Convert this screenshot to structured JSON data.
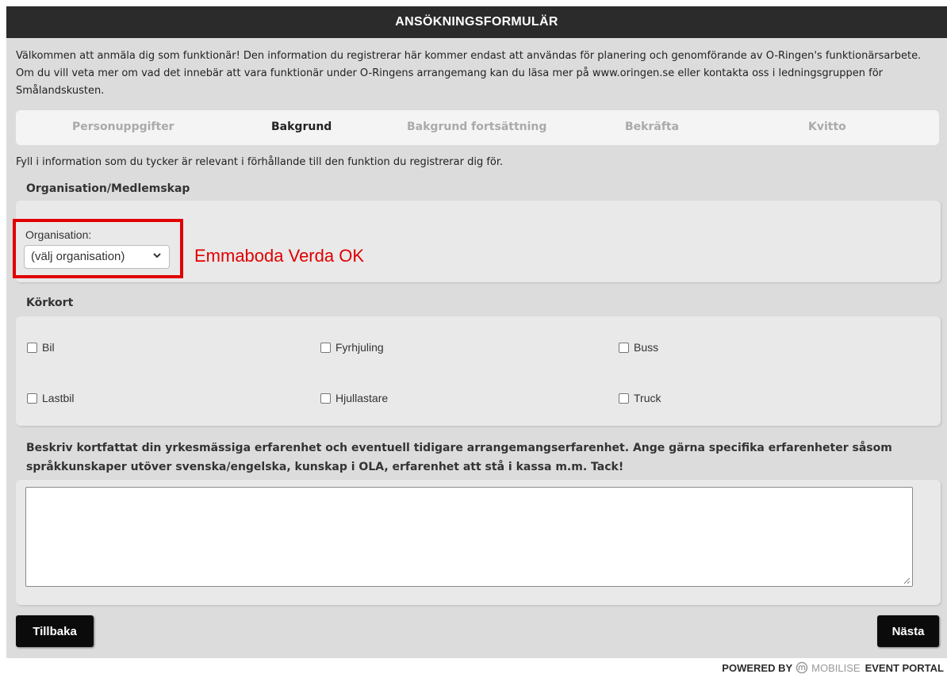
{
  "header": {
    "title": "ANSÖKNINGSFORMULÄR"
  },
  "intro": "Välkommen att anmäla dig som funktionär! Den information du registrerar här kommer endast att användas för planering och genomförande av O-Ringen's funktionärsarbete. Om du vill veta mer om vad det innebär att vara funktionär under O-Ringens arrangemang kan du läsa mer på www.oringen.se eller kontakta oss i ledningsgruppen för Smålandskusten.",
  "steps": [
    {
      "label": "Personuppgifter",
      "active": false
    },
    {
      "label": "Bakgrund",
      "active": true
    },
    {
      "label": "Bakgrund fortsättning",
      "active": false
    },
    {
      "label": "Bekräfta",
      "active": false
    },
    {
      "label": "Kvitto",
      "active": false
    }
  ],
  "lead_text": "Fyll i information som du tycker är relevant i förhållande till den funktion du registrerar dig för.",
  "organisation_section": {
    "title": "Organisation/Medlemskap",
    "label": "Organisation:",
    "select_value": "(välj organisation)",
    "annotation": "Emmaboda Verda OK",
    "annotation_color": "#e00000"
  },
  "license_section": {
    "title": "Körkort",
    "options": [
      {
        "label": "Bil",
        "checked": false
      },
      {
        "label": "Fyrhjuling",
        "checked": false
      },
      {
        "label": "Buss",
        "checked": false
      },
      {
        "label": "Lastbil",
        "checked": false
      },
      {
        "label": "Hjullastare",
        "checked": false
      },
      {
        "label": "Truck",
        "checked": false
      }
    ]
  },
  "experience": {
    "prompt": "Beskriv kortfattat din yrkesmässiga erfarenhet och eventuell tidigare arrangemangserfarenhet. Ange gärna specifika erfarenheter såsom språkkunskaper utöver svenska/engelska, kunskap i OLA, erfarenhet att stå i kassa m.m. Tack!",
    "value": ""
  },
  "buttons": {
    "back": "Tillbaka",
    "next": "Nästa"
  },
  "footer": {
    "powered_by": "POWERED BY",
    "brand": "MOBILISE",
    "product": "EVENT PORTAL"
  },
  "colors": {
    "header_bg": "#2b2b2b",
    "page_bg": "#dcdcdc",
    "panel_bg": "#e9e9e9",
    "button_bg": "#0b0b0b"
  }
}
